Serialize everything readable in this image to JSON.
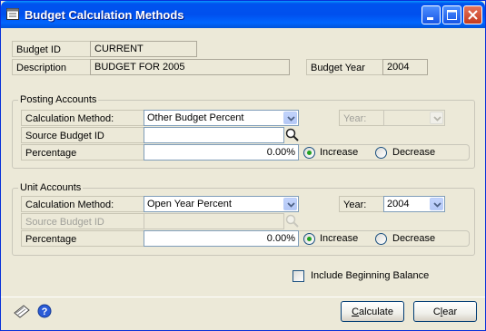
{
  "window": {
    "title": "Budget Calculation Methods",
    "icon": "budget-window-icon"
  },
  "header": {
    "budget_id_label": "Budget ID",
    "budget_id_value": "CURRENT",
    "description_label": "Description",
    "description_value": "BUDGET FOR 2005",
    "budget_year_label": "Budget Year",
    "budget_year_value": "2004"
  },
  "posting": {
    "group_label": "Posting Accounts",
    "calc_method_label": "Calculation Method:",
    "calc_method_value": "Other Budget Percent",
    "year_label": "Year:",
    "year_value": "",
    "source_label": "Source Budget ID",
    "source_value": "",
    "percentage_label": "Percentage",
    "percentage_value": "0.00%",
    "increase_label": "Increase",
    "decrease_label": "Decrease",
    "selected": "Increase"
  },
  "unit": {
    "group_label": "Unit Accounts",
    "calc_method_label": "Calculation Method:",
    "calc_method_value": "Open Year Percent",
    "year_label": "Year:",
    "year_value": "2004",
    "source_label": "Source Budget ID",
    "source_value": "",
    "percentage_label": "Percentage",
    "percentage_value": "0.00%",
    "increase_label": "Increase",
    "decrease_label": "Decrease",
    "selected": "Increase"
  },
  "include_beginning_balance": {
    "label": "Include Beginning Balance",
    "checked": false
  },
  "footer": {
    "calculate_button": {
      "pre": "",
      "accel": "C",
      "post": "alculate"
    },
    "clear_button": {
      "pre": "C",
      "accel": "l",
      "post": "ear"
    }
  },
  "colors": {
    "titlebar": "#0053ee",
    "window_bg": "#ece9d8",
    "radio_dot": "#21a121"
  }
}
